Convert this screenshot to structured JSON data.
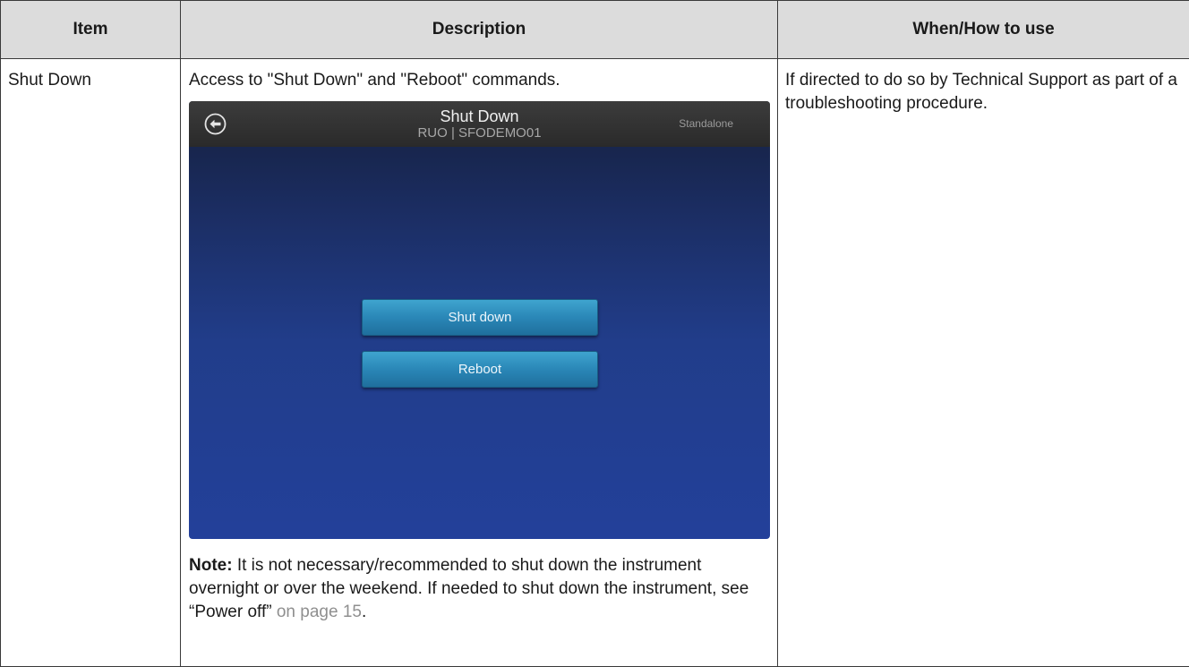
{
  "table": {
    "headers": [
      "Item",
      "Description",
      "When/How to use"
    ],
    "row": {
      "item": "Shut Down",
      "description_intro": "Access to \"Shut Down\" and \"Reboot\" commands.",
      "when_how": "If directed to do so by Technical Support as part of a troubleshooting procedure."
    }
  },
  "screen": {
    "title": "Shut Down",
    "subtitle": "RUO | SFODEMO01",
    "mode": "Standalone",
    "back_icon": "arrow-left-circle-icon",
    "buttons": {
      "shutdown_label": "Shut down",
      "reboot_label": "Reboot"
    },
    "colors": {
      "header_bg": "#2e2e2e",
      "screen_bg_top": "#15203e",
      "screen_bg_bottom": "#23409a",
      "button_bg": "#2a87b7"
    }
  },
  "note": {
    "label": "Note:",
    "text": "It is not necessary/recommended to shut down the instrument overnight or over the weekend. If needed to shut down the instrument, see “Power off”",
    "link_text": "on page 15",
    "end": "."
  }
}
